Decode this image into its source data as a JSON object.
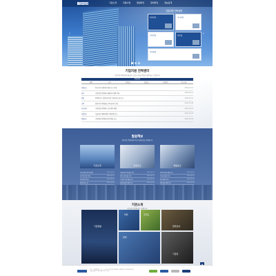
{
  "header": {
    "logo_text": "기업지원센터",
    "nav": [
      "기관소개",
      "지원사업",
      "알림마당",
      "참여마당",
      "정보공개"
    ]
  },
  "hero": {
    "label": "기업지원 전략센터",
    "tiles": [
      {
        "label": "지원사업"
      },
      {
        "label": "공지사항"
      },
      {
        "label": "교육신청"
      },
      {
        "label": "자료실"
      },
      {
        "label": "기업상담"
      }
    ],
    "prev_glyph": "‹",
    "next_glyph": "›"
  },
  "center": {
    "title": "기업지원 전략센터",
    "subtitle": "기업지원 전략센터의 새로운 소식과 다양한 정보를 확인하실 수 있습니다.",
    "notice_title": "알림마당",
    "columns": [
      "전체",
      "공지",
      "사업공고",
      "입찰공고",
      "교육행사",
      "보도자료"
    ],
    "rows": [
      {
        "cat": "사업공고",
        "title": "중소기업 지원사업 통합 공고 안내",
        "date": "2016.04.12"
      },
      {
        "cat": "공지",
        "title": "기업지원 전략센터 홈페이지 개편 안내",
        "date": "2016.04.11"
      },
      {
        "cat": "입찰",
        "title": "2016년도 기업지원 사업 수행기관 모집 공고",
        "date": "2016.04.10"
      },
      {
        "cat": "교육",
        "title": "창업기업 역량강화 교육 참가자 모집",
        "date": "2016.04.08"
      },
      {
        "cat": "보도자료",
        "title": "기업지원 전략센터 신규 협약 체결",
        "date": "2016.04.07"
      },
      {
        "cat": "사업공고",
        "title": "수출기업 해외마케팅 지원사업 공고",
        "date": "2016.04.05"
      },
      {
        "cat": "입찰공고",
        "title": "기업지원 전략센터 용역 입찰 공고",
        "date": "2016.04.03"
      }
    ]
  },
  "program": {
    "title": "발원책보",
    "subtitle": "기업지원 전략센터의 주요 지원사업을 안내합니다.",
    "cards": [
      {
        "caption": "기관소개",
        "items": [
          {
            "a": "기관 설립 목적 및 비전",
            "b": "2016.04.12"
          },
          {
            "a": "조직 및 업무 안내",
            "b": "2016.04.11"
          },
          {
            "a": "주요 연혁 안내",
            "b": "2016.04.10"
          },
          {
            "a": "찾아오시는 길",
            "b": "2016.04.09"
          }
        ]
      },
      {
        "caption": "입찰공고",
        "items": [
          {
            "a": "기업지원 용역 입찰 공고",
            "b": "2016.04.12"
          },
          {
            "a": "장비 구매 입찰 공고",
            "b": "2016.04.11"
          },
          {
            "a": "시스템 구축 입찰 공고",
            "b": "2016.04.10"
          },
          {
            "a": "홍보물 제작 입찰 공고",
            "b": "2016.04.09"
          }
        ]
      },
      {
        "caption": "채용공고",
        "items": [
          {
            "a": "계약직 직원 채용 공고",
            "b": "2016.04.12"
          },
          {
            "a": "연구원 채용 공고",
            "b": "2016.04.11"
          },
          {
            "a": "인턴 채용 공고",
            "b": "2016.04.10"
          },
          {
            "a": "전문위원 채용 공고",
            "b": "2016.04.09"
          }
        ]
      }
    ]
  },
  "intro": {
    "title": "기관소개",
    "subtitle": "기업지원 전략센터를 소개합니다.",
    "blocks": [
      "기관현황",
      "비전",
      "조직도",
      "업무안내",
      "연혁",
      "기관장"
    ]
  },
  "footer": {
    "text": "주소 : 서울특별시 ○○구 ○○로 00 기업지원 전략센터 | 대표전화 : 02-000-0000 | Copyright © All rights reserved."
  },
  "colors": {
    "primary": "#1b3f78",
    "accent": "#3e5e98"
  }
}
